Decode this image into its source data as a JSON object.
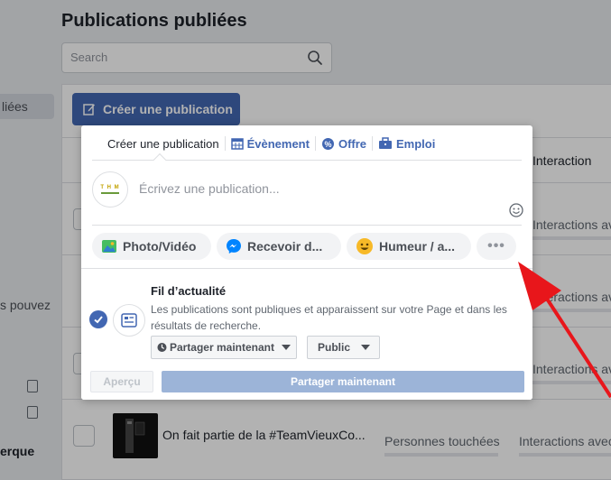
{
  "page": {
    "title": "Publications publiées",
    "search_placeholder": "Search"
  },
  "sidebar": {
    "active_fragment": "liées",
    "text_fragment": "s pouvez",
    "bold_fragment": "erque"
  },
  "toolbar": {
    "create_label": "Créer une publication"
  },
  "table": {
    "col_interaction": "Interaction",
    "row_reach_label": "Personnes touchées",
    "row_interactions_label": "Interactions avec",
    "row_title": "On fait partie de la #TeamVieuxCo..."
  },
  "composer": {
    "tabs": [
      {
        "label": "Créer une publication",
        "icon": "pencil-icon"
      },
      {
        "label": "Évènement",
        "icon": "calendar-icon"
      },
      {
        "label": "Offre",
        "icon": "offer-icon"
      },
      {
        "label": "Emploi",
        "icon": "briefcase-icon"
      }
    ],
    "avatar_letters": "T H M",
    "placeholder": "Écrivez une publication...",
    "chips": [
      {
        "label": "Photo/Vidéo",
        "icon": "photo-icon"
      },
      {
        "label": "Recevoir d...",
        "icon": "messenger-icon"
      },
      {
        "label": "Humeur / a...",
        "icon": "smiley-icon"
      }
    ],
    "more_label": "•••",
    "share": {
      "title": "Fil d’actualité",
      "description": "Les publications sont publiques et apparaissent sur votre Page et dans les résultats de recherche.",
      "when_label": "Partager maintenant",
      "audience_label": "Public",
      "preview_label": "Aperçu",
      "submit_label": "Partager maintenant"
    }
  },
  "colors": {
    "brand": "#4267b2",
    "annotation_arrow": "#e8161b"
  }
}
